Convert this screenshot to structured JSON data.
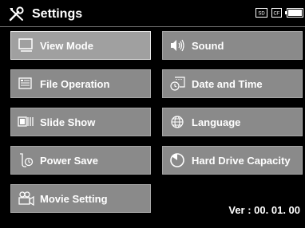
{
  "header": {
    "title": "Settings",
    "icons": [
      "wrench-screwdriver-icon",
      "sd-card-icon",
      "cf-card-icon",
      "battery-icon"
    ],
    "sd_label": "SD",
    "cf_label": "CF"
  },
  "menu": {
    "left": [
      {
        "label": "View Mode",
        "icon": "monitor-icon",
        "selected": true
      },
      {
        "label": "File Operation",
        "icon": "file-list-icon"
      },
      {
        "label": "Slide Show",
        "icon": "slideshow-icon"
      },
      {
        "label": "Power Save",
        "icon": "power-save-icon"
      },
      {
        "label": "Movie Setting",
        "icon": "movie-camera-icon"
      }
    ],
    "right": [
      {
        "label": "Sound",
        "icon": "speaker-icon"
      },
      {
        "label": "Date and Time",
        "icon": "calendar-clock-icon"
      },
      {
        "label": "Language",
        "icon": "globe-icon"
      },
      {
        "label": "Hard Drive Capacity",
        "icon": "pie-chart-icon"
      }
    ]
  },
  "footer": {
    "version": "Ver : 00. 01. 00"
  },
  "colors": {
    "background": "#000000",
    "tile": "#8a8a8a",
    "tile_selected": "#a0a0a0",
    "text": "#ffffff"
  }
}
